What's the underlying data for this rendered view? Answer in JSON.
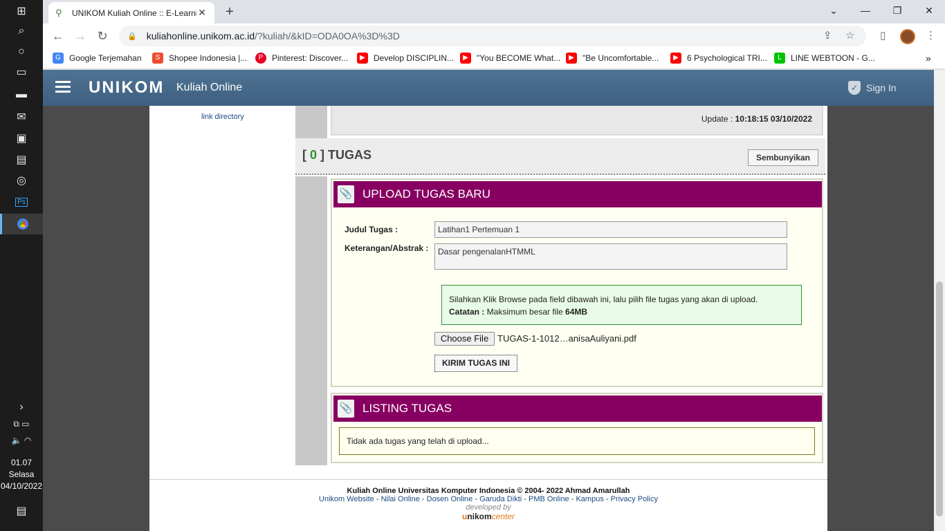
{
  "taskbar": {
    "clock_time": "01.07",
    "clock_day": "Selasa",
    "clock_date": "04/10/2022"
  },
  "browser": {
    "tab_title": "UNIKOM Kuliah Online :: E-Learning",
    "tab_close": "✕",
    "new_tab": "+",
    "url_host": "kuliahonline.unikom.ac.id",
    "url_path": "/?kuliah/&kID=ODA0OA%3D%3D",
    "bookmarks": [
      {
        "label": "Google Terjemahan",
        "icon": "google-translate-icon",
        "color": "#4285f4"
      },
      {
        "label": "Shopee Indonesia |...",
        "icon": "shopee-icon",
        "color": "#ee4d2d"
      },
      {
        "label": "Pinterest: Discover...",
        "icon": "pinterest-icon",
        "color": "#e60023"
      },
      {
        "label": "Develop DISCIPLIN...",
        "icon": "youtube-icon",
        "color": "#ff0000"
      },
      {
        "label": "\"You BECOME What...",
        "icon": "youtube-icon",
        "color": "#ff0000"
      },
      {
        "label": "\"Be Uncomfortable...",
        "icon": "youtube-icon",
        "color": "#ff0000"
      },
      {
        "label": "6 Psychological TRI...",
        "icon": "youtube-icon",
        "color": "#ff0000"
      },
      {
        "label": "LINE WEBTOON - G...",
        "icon": "webtoon-icon",
        "color": "#00c300"
      }
    ],
    "bookmarks_more": "»"
  },
  "site": {
    "brand": "UNIKOM",
    "subtitle": "Kuliah Online",
    "sign_in": "Sign In",
    "link_directory": "link directory",
    "update_label": "Update : ",
    "update_value": "10:18:15 03/10/2022",
    "tugas_count": "0",
    "tugas_title": "TUGAS",
    "hide_button": "Sembunyikan",
    "upload_panel_title": "UPLOAD TUGAS BARU",
    "judul_label": "Judul Tugas :",
    "judul_value": "Latihan1 Pertemuan 1",
    "keterangan_label": "Keterangan/Abstrak :",
    "keterangan_value": "Dasar pengenalanHTMML",
    "info_line1": "Silahkan Klik Browse pada field dibawah ini, lalu pilih file tugas yang akan di upload.",
    "info_catatan": "Catatan :",
    "info_max": " Maksimum besar file ",
    "info_size": "64MB",
    "choose_file": "Choose File",
    "file_name": "TUGAS-1-1012…anisaAuliyani.pdf",
    "submit_button": "KIRIM TUGAS INI",
    "listing_panel_title": "LISTING TUGAS",
    "listing_empty": "Tidak ada tugas yang telah di upload...",
    "footer_line1": "Kuliah Online Universitas Komputer Indonesia © 2004- 2022 Ahmad Amarullah",
    "footer_links": [
      "Unikom Website",
      "Nilai Online",
      "Dosen Online",
      "Garuda Dikti",
      "PMB Online",
      "Kampus",
      "Privacy Policy"
    ],
    "footer_developed": "developed by",
    "footer_brand_u": "u",
    "footer_brand_nikom": "nikom",
    "footer_brand_center": "center"
  },
  "colors": {
    "appbar": "#4b6e8e",
    "panel_header": "#870061",
    "info_border": "#2f8f2f"
  }
}
